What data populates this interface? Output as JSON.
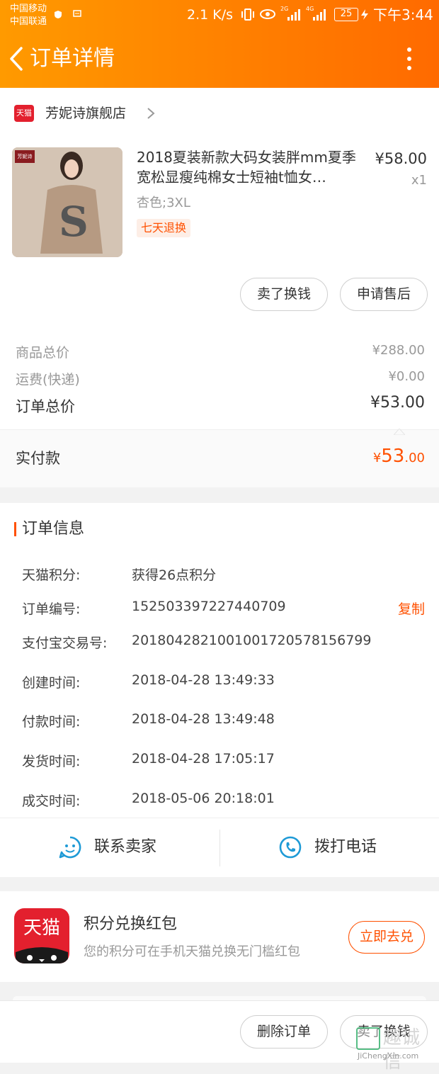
{
  "status_bar": {
    "carrier1": "中国移动",
    "carrier2": "中国联通",
    "speed": "2.1 K/s",
    "net1": "2G",
    "net2": "4G",
    "battery": "25",
    "time": "下午3:44"
  },
  "header": {
    "title": "订单详情"
  },
  "shop": {
    "name": "芳妮诗旗舰店",
    "badge": "天猫"
  },
  "product": {
    "thumb_brand": "芳妮诗",
    "title": "2018夏装新款大码女装胖mm夏季宽松显瘦纯棉女士短袖t恤女…",
    "price": "¥58.00",
    "qty": "x1",
    "sku": "杏色;3XL",
    "tag": "七天退换"
  },
  "product_actions": {
    "sell": "卖了换钱",
    "after_sale": "申请售后"
  },
  "price_summary": {
    "goods_label": "商品总价",
    "goods_value": "¥288.00",
    "shipping_label": "运费(快递)",
    "shipping_value": "¥0.00",
    "order_label": "订单总价",
    "order_value": "¥53.00"
  },
  "paid": {
    "label": "实付款",
    "symbol": "¥",
    "int": "53",
    "dec": ".00"
  },
  "order_info": {
    "title": "订单信息",
    "copy": "复制",
    "rows": [
      {
        "label": "天猫积分:",
        "value": "获得26点积分"
      },
      {
        "label": "订单编号:",
        "value": "152503397227440709"
      },
      {
        "label": "支付宝交易号:",
        "value": "2018042821001001720578156799"
      },
      {
        "label": "创建时间:",
        "value": "2018-04-28 13:49:33"
      },
      {
        "label": "付款时间:",
        "value": "2018-04-28 13:49:48"
      },
      {
        "label": "发货时间:",
        "value": "2018-04-28 17:05:17"
      },
      {
        "label": "成交时间:",
        "value": "2018-05-06 20:18:01"
      }
    ]
  },
  "contact": {
    "seller": "联系卖家",
    "call": "拨打电话"
  },
  "promo": {
    "logo_text": "天猫",
    "title": "积分兑换红包",
    "desc": "您的积分可在手机天猫兑换无门槛红包",
    "button": "立即去兑"
  },
  "bottom": {
    "delete": "删除订单",
    "sell": "卖了换钱"
  },
  "watermark": {
    "text": "JiChengXin.com",
    "cn": "趣诚信"
  },
  "colors": {
    "accent": "#ff5000",
    "tmall_red": "#e3202e",
    "icon_blue": "#1e9ad6"
  }
}
